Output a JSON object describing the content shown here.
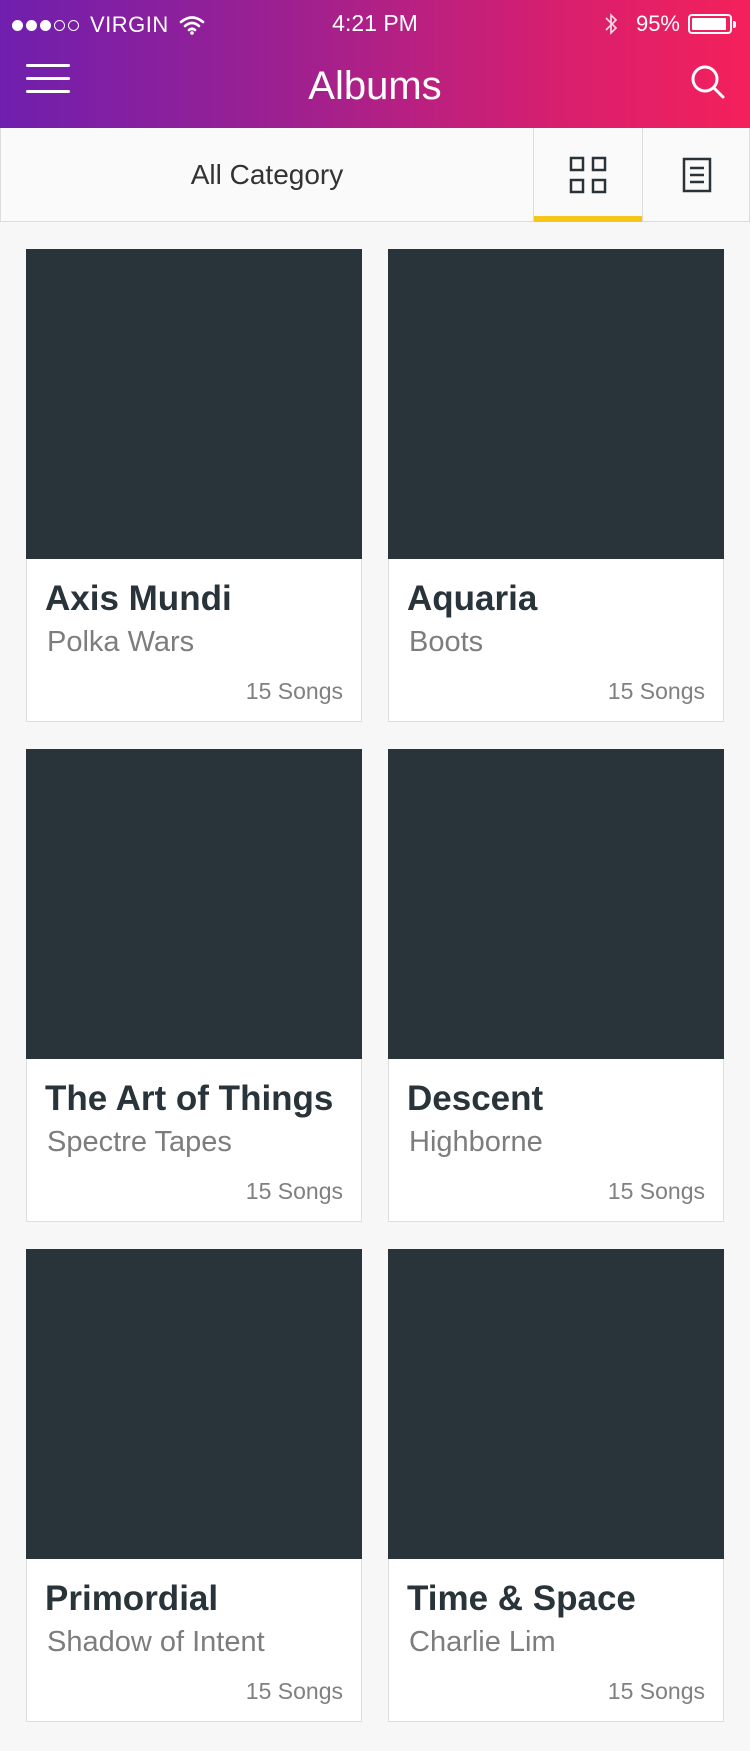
{
  "status_bar": {
    "signal_filled": 3,
    "signal_total": 5,
    "carrier": "VIRGIN",
    "time": "4:21 PM",
    "battery_percent_label": "95%",
    "battery_level": 0.95
  },
  "header": {
    "title": "Albums"
  },
  "toolbar": {
    "category_label": "All Category",
    "active_view": "grid",
    "accent_color": "#f5c518"
  },
  "albums": [
    {
      "name": "Axis Mundi",
      "artist": "Polka Wars",
      "songs": "15 Songs"
    },
    {
      "name": "Aquaria",
      "artist": "Boots",
      "songs": "15 Songs"
    },
    {
      "name": "The Art of Things",
      "artist": "Spectre Tapes",
      "songs": "15 Songs"
    },
    {
      "name": "Descent",
      "artist": "Highborne",
      "songs": "15 Songs"
    },
    {
      "name": "Primordial",
      "artist": "Shadow of Intent",
      "songs": "15 Songs"
    },
    {
      "name": "Time & Space",
      "artist": "Charlie Lim",
      "songs": "15 Songs"
    }
  ],
  "colors": {
    "gradient_start": "#6f1fae",
    "gradient_end": "#f4205a",
    "cover_placeholder": "#29333a"
  }
}
